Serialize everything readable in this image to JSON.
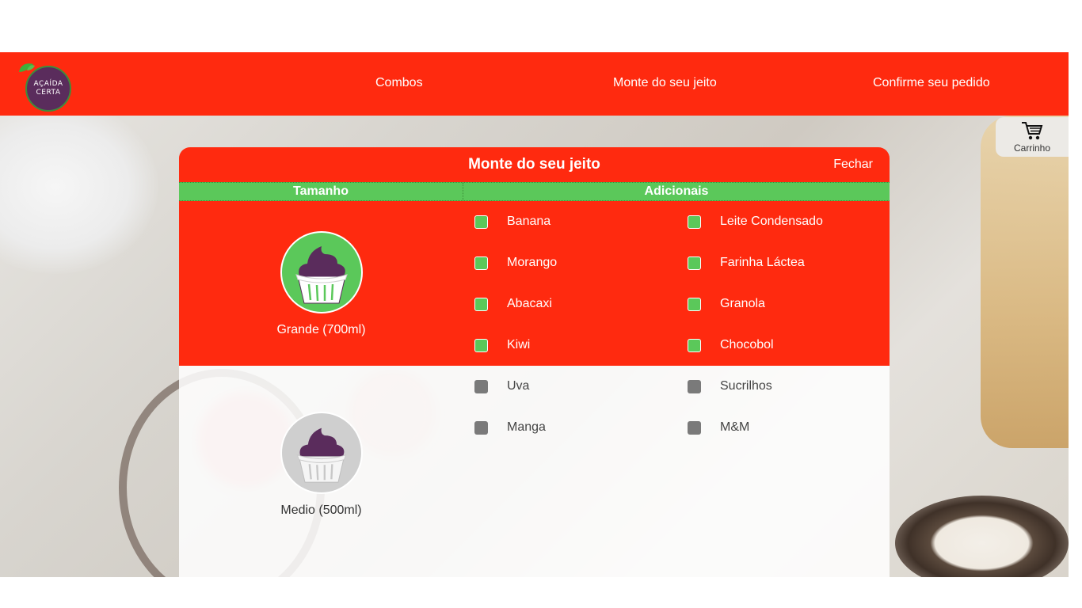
{
  "brand": {
    "logo_line1": "AÇAÍDA",
    "logo_line2": "CERTA"
  },
  "nav": {
    "links": [
      {
        "label": "Combos"
      },
      {
        "label": "Monte do seu jeito"
      },
      {
        "label": "Confirme seu pedido"
      }
    ]
  },
  "cart": {
    "label": "Carrinho"
  },
  "modal": {
    "title": "Monte do seu jeito",
    "close_label": "Fechar",
    "size_header": "Tamanho",
    "extras_header": "Adicionais",
    "sizes": [
      {
        "label": "Grande (700ml)",
        "selected": true
      },
      {
        "label": "Medio (500ml)",
        "selected": false
      }
    ],
    "extras": [
      {
        "label": "Banana",
        "available": true
      },
      {
        "label": "Leite Condensado",
        "available": true
      },
      {
        "label": "Morango",
        "available": true
      },
      {
        "label": "Farinha Láctea",
        "available": true
      },
      {
        "label": "Abacaxi",
        "available": true
      },
      {
        "label": "Granola",
        "available": true
      },
      {
        "label": "Kiwi",
        "available": true
      },
      {
        "label": "Chocobol",
        "available": true
      },
      {
        "label": "Uva",
        "available": false
      },
      {
        "label": "Sucrilhos",
        "available": false
      },
      {
        "label": "Manga",
        "available": false
      },
      {
        "label": "M&M",
        "available": false
      }
    ]
  },
  "colors": {
    "brand_red": "#ff2a0f",
    "brand_green": "#5bc85a",
    "acai_purple": "#5a2c5c",
    "disabled_gray": "#7a7a7a"
  }
}
